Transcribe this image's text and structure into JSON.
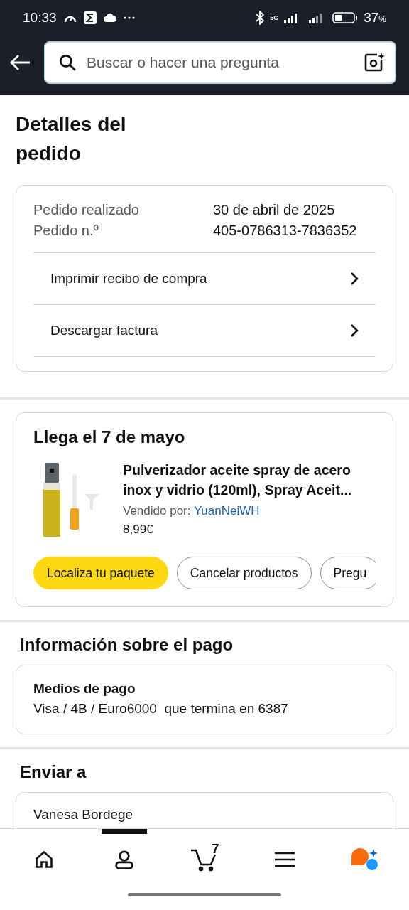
{
  "status_bar": {
    "time": "10:33",
    "network": "5G",
    "battery": "37",
    "battery_unit": "%"
  },
  "search": {
    "placeholder": "Buscar o hacer una pregunta"
  },
  "page_title": "Detalles del pedido",
  "order_summary": {
    "rows": [
      {
        "label": "Pedido realizado",
        "value": "30 de abril de 2025"
      },
      {
        "label": "Pedido n.º",
        "value": "405-0786313-7836352"
      }
    ],
    "links": [
      "Imprimir recibo de compra",
      "Descargar factura"
    ]
  },
  "shipment": {
    "title": "Llega el 7 de mayo",
    "product": {
      "name": "Pulverizador aceite spray de acero inox y vidrio (120ml), Spray Aceit...",
      "seller_label": "Vendido por:",
      "seller": "YuanNeiWH",
      "price": "8,99€"
    },
    "actions": [
      {
        "label": "Localiza tu paquete",
        "kind": "primary"
      },
      {
        "label": "Cancelar productos",
        "kind": "secondary"
      },
      {
        "label": "Pregu",
        "kind": "secondary"
      }
    ]
  },
  "payment": {
    "title": "Información sobre el pago",
    "method_title": "Medios de pago",
    "method": "Visa / 4B / Euro6000  que termina en 6387"
  },
  "shipping": {
    "title": "Enviar a",
    "name": "Vanesa Bordege"
  },
  "bottom_nav": [
    {
      "kind": "home",
      "selected": false
    },
    {
      "kind": "account",
      "selected": true
    },
    {
      "kind": "cart",
      "count": "7",
      "selected": false
    },
    {
      "kind": "menu",
      "selected": false
    },
    {
      "kind": "assistant",
      "selected": false
    }
  ]
}
